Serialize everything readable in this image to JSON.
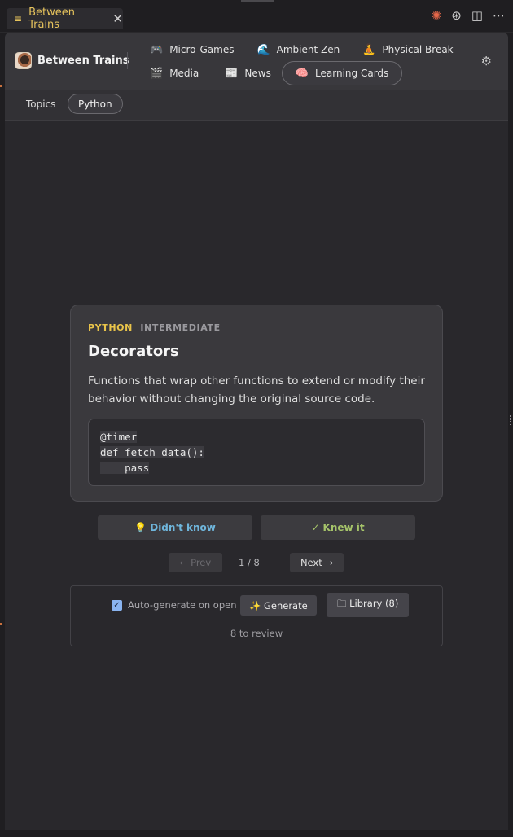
{
  "tab": {
    "title": "Between Trains",
    "menu_icon": "≡",
    "close_icon": "✕"
  },
  "window_actions": {
    "spark": "✺",
    "openai": "⊛",
    "split": "◫",
    "more": "⋯"
  },
  "header": {
    "brand": "Between Trains",
    "settings_icon": "⚙",
    "nav_row1": [
      {
        "icon": "🎮",
        "label": "Micro-Games"
      },
      {
        "icon": "🌊",
        "label": "Ambient Zen"
      },
      {
        "icon": "🧘",
        "label": "Physical Break"
      }
    ],
    "nav_row2": [
      {
        "icon": "🎬",
        "label": "Media"
      },
      {
        "icon": "📰",
        "label": "News"
      },
      {
        "icon": "🧠",
        "label": "Learning Cards"
      }
    ],
    "active_nav": "Learning Cards"
  },
  "subtabs": [
    "Topics",
    "Python"
  ],
  "active_subtab": "Python",
  "card": {
    "language": "PYTHON",
    "level": "INTERMEDIATE",
    "title": "Decorators",
    "body": "Functions that wrap other functions to extend or modify their behavior without changing the original source code.",
    "code": [
      "@timer",
      "def fetch_data():",
      "    pass"
    ]
  },
  "answers": {
    "unknown": "💡 Didn't know",
    "known": "✓ Knew it"
  },
  "pager": {
    "prev": "← Prev",
    "count": "1 / 8",
    "next": "Next →"
  },
  "generator": {
    "auto_label": "Auto-generate on open",
    "auto_checked": true,
    "generate": "✨ Generate",
    "library": "🗀 Library (8)",
    "review": "8 to review"
  },
  "colors": {
    "accent_yellow": "#e9c44a",
    "link_blue": "#6fb6dc",
    "ok_green": "#a6c46a"
  }
}
